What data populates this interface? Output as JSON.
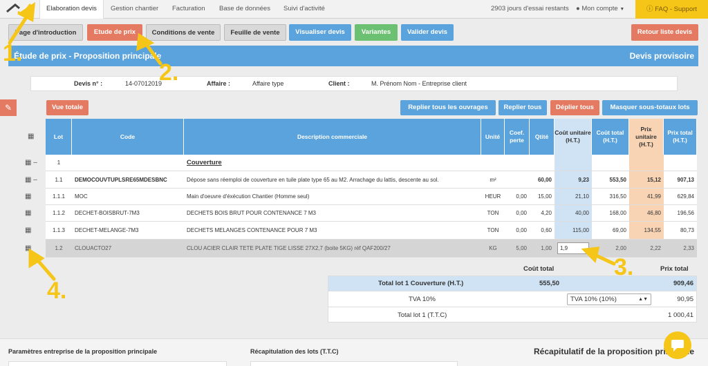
{
  "nav": {
    "tabs": [
      "Elaboration devis",
      "Gestion chantier",
      "Facturation",
      "Base de données",
      "Suivi d'activité"
    ],
    "trial": "2903 jours d'essai restants",
    "account": "Mon compte",
    "faq": "FAQ - Support"
  },
  "toolbar": {
    "intro": "Page d'introduction",
    "etude": "Etude de prix",
    "conditions": "Conditions de vente",
    "feuille": "Feuille de vente",
    "visualiser": "Visualiser devis",
    "variantes": "Variantes",
    "valider": "Valider devis",
    "retour": "Retour liste devis"
  },
  "banner": {
    "title": "Étude de prix - Proposition principale",
    "status": "Devis provisoire"
  },
  "info": {
    "devis_label": "Devis n° :",
    "devis_value": "14-07012019",
    "affaire_label": "Affaire :",
    "affaire_value": "Affaire type",
    "client_label": "Client :",
    "client_value": "M. Prénom Nom - Entreprise client"
  },
  "actions": {
    "vue_totale": "Vue totale",
    "replier_ouvrages": "Replier tous les ouvrages",
    "replier_tous": "Replier tous",
    "deplier_tous": "Déplier tous",
    "masquer": "Masquer sous-totaux lots"
  },
  "table": {
    "headers": {
      "lot": "Lot",
      "code": "Code",
      "description": "Description commerciale",
      "unite": "Unité",
      "coef": "Coef. perte",
      "qte": "Qtité",
      "cout_unitaire": "Coût unitaire (H.T.)",
      "cout_total": "Coût total (H.T.)",
      "prix_unitaire": "Prix unitaire (H.T.)",
      "prix_total": "Prix total (H.T.)"
    },
    "rows": [
      {
        "lot": "1",
        "code": "",
        "description": "Couverture",
        "unite": "",
        "coef": "",
        "qte": "",
        "cu": "",
        "ct": "",
        "pu": "",
        "pt": ""
      },
      {
        "lot": "1.1",
        "code": "DEMOCOUVTUPLSRE65MDESBNC",
        "description": "Dépose sans réemploi de couverture en tuile plate type 65 au M2. Arrachage du lattis, descente au sol.",
        "unite": "m²",
        "coef": "",
        "qte": "60,00",
        "cu": "9,23",
        "ct": "553,50",
        "pu": "15,12",
        "pt": "907,13"
      },
      {
        "lot": "1.1.1",
        "code": "MOC",
        "description": "Main d'oeuvre d'éxécution Chantier (Homme seul)",
        "unite": "HEUR",
        "coef": "0,00",
        "qte": "15,00",
        "cu": "21,10",
        "ct": "316,50",
        "pu": "41,99",
        "pt": "629,84"
      },
      {
        "lot": "1.1.2",
        "code": "DECHET-BOISBRUT-7M3",
        "description": "DECHETS BOIS BRUT POUR CONTENANCE 7 M3",
        "unite": "TON",
        "coef": "0,00",
        "qte": "4,20",
        "cu": "40,00",
        "ct": "168,00",
        "pu": "46,80",
        "pt": "196,56"
      },
      {
        "lot": "1.1.3",
        "code": "DECHET-MELANGE-7M3",
        "description": "DECHETS MELANGES CONTENANCE POUR 7 M3",
        "unite": "TON",
        "coef": "0,00",
        "qte": "0,60",
        "cu": "115,00",
        "ct": "69,00",
        "pu": "134,55",
        "pt": "80,73"
      },
      {
        "lot": "1.2",
        "code": "CLOUACTO27",
        "description": "CLOU ACIER CLAIR TETE PLATE TIGE LISSE 27X2,7 (boite 5KG) réf QAF200/27",
        "unite": "KG",
        "coef": "5,00",
        "qte": "1,00",
        "cu": "1,9",
        "ct": "2,00",
        "pu": "2,22",
        "pt": "2,33"
      }
    ]
  },
  "totals": {
    "cout_total_label": "Coût total",
    "prix_total_label": "Prix total",
    "lot_label": "Total lot 1 Couverture (H.T.)",
    "lot_cout": "555,50",
    "lot_prix": "909,46",
    "tva_label": "TVA 10%",
    "tva_select": "TVA 10% (10%)",
    "tva_value": "90,95",
    "ttc_label": "Total lot 1 (T.T.C)",
    "ttc_value": "1 000,41"
  },
  "footer": {
    "params": "Paramètres entreprise de la proposition principale",
    "recap_lots": "Récapitulation des lots (T.T.C)",
    "recap_prop": "Récapitulatif de la proposition principale"
  },
  "annotations": [
    "1.",
    "2.",
    "3.",
    "4."
  ],
  "colors": {
    "accent": "#5ba3dc",
    "red": "#e57a62",
    "yellow": "#f5c518",
    "header": "#5ba3dc",
    "cu_col": "#cfe3f5",
    "pu_col": "#f8d4b4"
  }
}
